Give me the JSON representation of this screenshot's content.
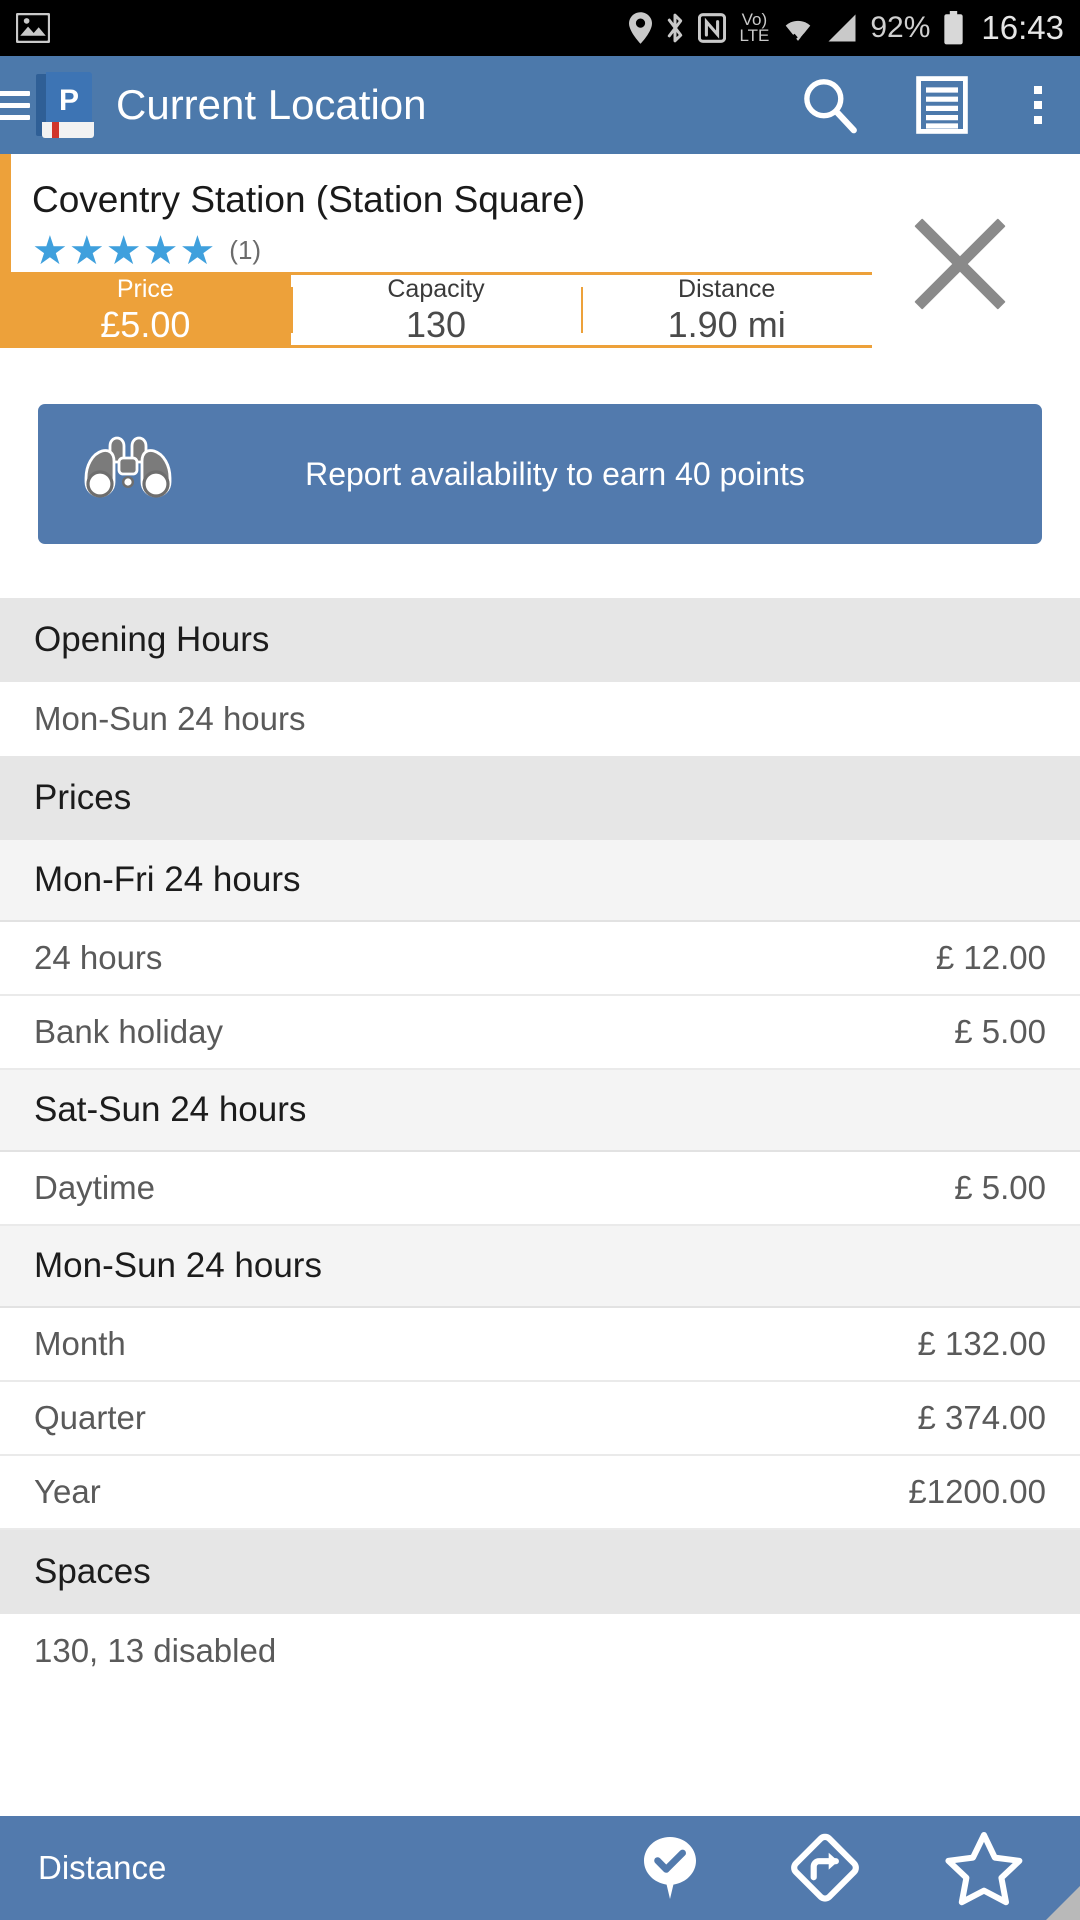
{
  "status_bar": {
    "left_icons": [
      "image-icon"
    ],
    "right_icons": [
      "location-icon",
      "bluetooth-icon",
      "nfc-icon"
    ],
    "network_mode_top": "Vo)",
    "network_mode_bottom": "LTE",
    "battery_percent": "92%",
    "time": "16:43"
  },
  "app_bar": {
    "menu_icon": "hamburger-icon",
    "logo_letter": "P",
    "title": "Current Location",
    "actions": [
      "search-icon",
      "list-icon",
      "overflow-menu-icon"
    ]
  },
  "info_card": {
    "place_name": "Coventry Station (Station Square)",
    "stars": 5,
    "star_glyph": "★",
    "rating_count": "(1)",
    "close_label": "close-icon"
  },
  "stats": [
    {
      "label": "Price",
      "value": "£5.00",
      "active": true
    },
    {
      "label": "Capacity",
      "value": "130",
      "active": false
    },
    {
      "label": "Distance",
      "value": "1.90 mi",
      "active": false
    }
  ],
  "banner": {
    "icon": "binoculars-icon",
    "text": "Report availability to earn 40 points"
  },
  "sections": [
    {
      "type": "section",
      "title": "Opening Hours",
      "items": [
        {
          "type": "plain",
          "text": "Mon-Sun 24 hours"
        }
      ]
    },
    {
      "type": "section",
      "title": "Prices",
      "items": [
        {
          "type": "sub",
          "text": "Mon-Fri 24 hours"
        },
        {
          "type": "kv",
          "key": "24 hours",
          "value": "£ 12.00"
        },
        {
          "type": "kv",
          "key": "Bank holiday",
          "value": "£ 5.00"
        },
        {
          "type": "sub",
          "text": "Sat-Sun 24 hours"
        },
        {
          "type": "kv",
          "key": "Daytime",
          "value": "£ 5.00"
        },
        {
          "type": "sub",
          "text": "Mon-Sun 24 hours"
        },
        {
          "type": "kv",
          "key": "Month",
          "value": "£ 132.00"
        },
        {
          "type": "kv",
          "key": "Quarter",
          "value": "£ 374.00"
        },
        {
          "type": "kv",
          "key": "Year",
          "value": "£1200.00"
        }
      ]
    },
    {
      "type": "section",
      "title": "Spaces",
      "items": [
        {
          "type": "plain",
          "text": "130, 13 disabled"
        }
      ]
    }
  ],
  "bottom_bar": {
    "sort_label": "Distance",
    "actions": [
      "check-in-icon",
      "directions-icon",
      "favourite-star-icon"
    ]
  },
  "colors": {
    "primary_blue": "#4c79ab",
    "banner_blue": "#527aad",
    "accent_orange": "#eda13a",
    "star_blue": "#3fa0dd",
    "section_grey": "#e6e6e6",
    "subheader_grey": "#f4f4f4"
  }
}
